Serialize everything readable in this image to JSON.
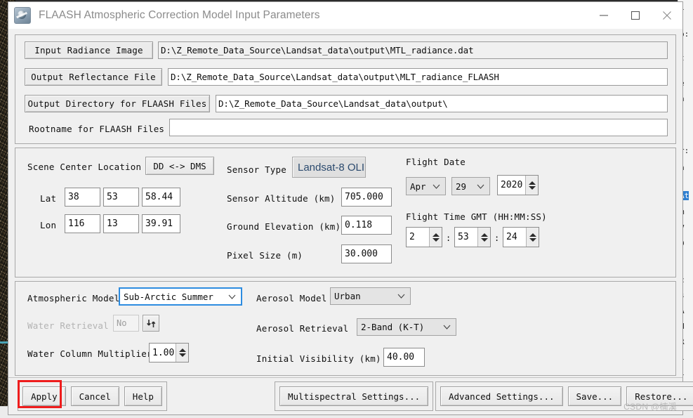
{
  "window": {
    "title": "FLAASH Atmospheric Correction Model Input Parameters",
    "icon": "flaash-app-icon",
    "controls": {
      "minimize": "minimize-icon",
      "maximize": "maximize-icon",
      "close": "close-icon"
    }
  },
  "files": {
    "input_radiance": {
      "label": "Input Radiance Image",
      "value": "D:\\Z_Remote_Data_Source\\Landsat_data\\output\\MTL_radiance.dat"
    },
    "output_reflectance": {
      "label": "Output Reflectance File",
      "value": "D:\\Z_Remote_Data_Source\\Landsat_data\\output\\MLT_radiance_FLAASH"
    },
    "output_directory": {
      "label": "Output Directory for FLAASH Files",
      "value": "D:\\Z_Remote_Data_Source\\Landsat_data\\output\\"
    },
    "rootname": {
      "label": "Rootname for FLAASH Files",
      "value": ""
    }
  },
  "scene": {
    "location_label": "Scene Center Location",
    "dd_dms_button": "DD <-> DMS",
    "lat_label": "Lat",
    "lat_deg": "38",
    "lat_min": "53",
    "lat_sec": "58.44",
    "lon_label": "Lon",
    "lon_deg": "116",
    "lon_min": "13",
    "lon_sec": "39.91"
  },
  "sensor": {
    "type_label": "Sensor Type",
    "type_value": "Landsat-8 OLI",
    "altitude_label": "Sensor Altitude (km)",
    "altitude_value": "705.000",
    "ground_elevation_label": "Ground Elevation (km)",
    "ground_elevation_value": "0.118",
    "pixel_size_label": "Pixel Size (m)",
    "pixel_size_value": "30.000"
  },
  "flight": {
    "date_label": "Flight Date",
    "month": "Apr",
    "day": "29",
    "year": "2020",
    "time_label": "Flight Time GMT (HH:MM:SS)",
    "hour": "2",
    "minute": "53",
    "second": "24",
    "sep1": ":",
    "sep2": ":"
  },
  "model": {
    "atmospheric_label": "Atmospheric Model",
    "atmospheric_value": "Sub-Arctic Summer",
    "water_retrieval_label": "Water Retrieval",
    "water_retrieval_value": "No",
    "water_retrieval_toggle": "updown-arrows-icon",
    "water_multiplier_label": "Water Column Multiplier",
    "water_multiplier_value": "1.00",
    "aerosol_model_label": "Aerosol Model",
    "aerosol_model_value": "Urban",
    "aerosol_retrieval_label": "Aerosol Retrieval",
    "aerosol_retrieval_value": "2-Band (K-T)",
    "visibility_label": "Initial Visibility (km)",
    "visibility_value": "40.00"
  },
  "buttons": {
    "apply": "Apply",
    "cancel": "Cancel",
    "help": "Help",
    "multispectral": "Multispectral Settings...",
    "advanced": "Advanced Settings...",
    "save": "Save...",
    "restore": "Restore..."
  },
  "overlay": {
    "apply_highlight_color": "#ee1c1c",
    "watermark": "CSDN @楠溪"
  },
  "background": {
    "right_lines": [
      "i",
      "o:",
      "t",
      "e",
      "n",
      "r:",
      "a",
      "At",
      "m",
      "V",
      "D",
      "c",
      "s",
      "A",
      "N",
      "R",
      "i",
      "i",
      "C",
      "a",
      "l"
    ]
  },
  "colors": {
    "accent_focus": "#2d8ce0",
    "sensor_text": "#2b4a6e",
    "title_text": "#8b8b8b",
    "dialog_bg": "#f0f0f0",
    "highlight": "#ee1c1c"
  }
}
